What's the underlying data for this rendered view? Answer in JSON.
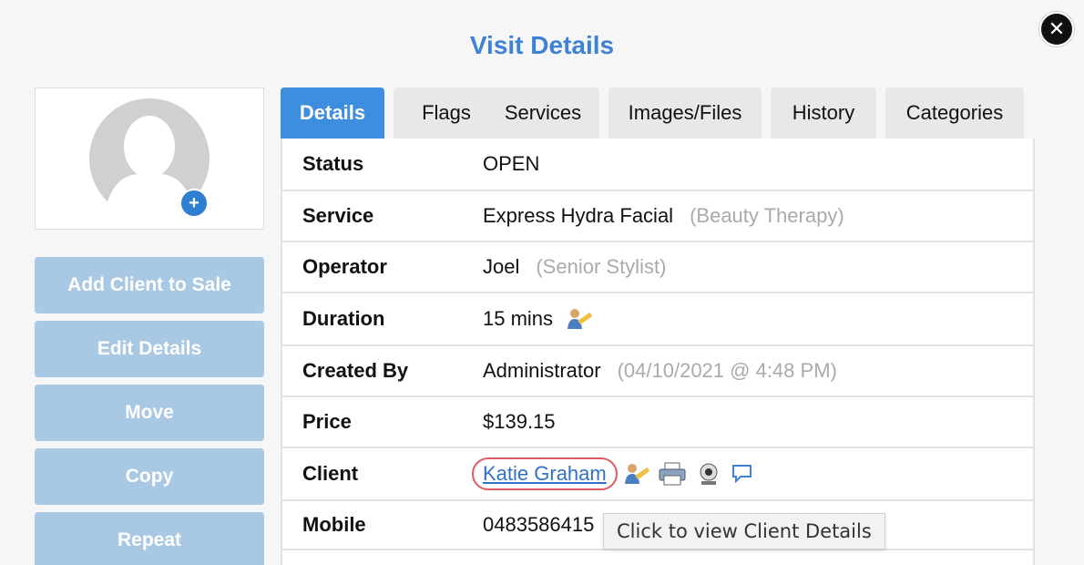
{
  "dialog": {
    "title": "Visit Details",
    "close_icon": "close-icon"
  },
  "sidebar": {
    "photo_icon": "avatar-placeholder-icon",
    "add_photo_label": "+",
    "buttons": [
      {
        "label": "Add Client to Sale"
      },
      {
        "label": "Edit Details"
      },
      {
        "label": "Move"
      },
      {
        "label": "Copy"
      },
      {
        "label": "Repeat"
      }
    ]
  },
  "tabs": [
    {
      "label": "Details",
      "active": true
    },
    {
      "label": "Flags",
      "active": false
    },
    {
      "label": "Services",
      "active": false
    },
    {
      "label": "Images/Files",
      "active": false
    },
    {
      "label": "History",
      "active": false
    },
    {
      "label": "Categories",
      "active": false
    }
  ],
  "details": {
    "status": {
      "label": "Status",
      "value": "OPEN"
    },
    "service": {
      "label": "Service",
      "value": "Express Hydra Facial",
      "note": "(Beauty Therapy)"
    },
    "operator": {
      "label": "Operator",
      "value": "Joel",
      "note": "(Senior Stylist)"
    },
    "duration": {
      "label": "Duration",
      "value": "15 mins",
      "icon": "edit-person-icon"
    },
    "created_by": {
      "label": "Created By",
      "value": "Administrator",
      "note": "(04/10/2021 @ 4:48 PM)"
    },
    "price": {
      "label": "Price",
      "value": "$139.15"
    },
    "client": {
      "label": "Client",
      "value": "Katie Graham",
      "icons": [
        "edit-person-icon",
        "printer-icon",
        "webcam-icon",
        "chat-icon"
      ]
    },
    "mobile": {
      "label": "Mobile",
      "value": "0483586415"
    }
  },
  "tooltip": {
    "text": "Click to view Client Details"
  },
  "colors": {
    "accent": "#3e82d6",
    "active_tab": "#3e8ee0",
    "sidebar_button": "#a8c8e4",
    "highlight_ring": "#e05a66"
  }
}
